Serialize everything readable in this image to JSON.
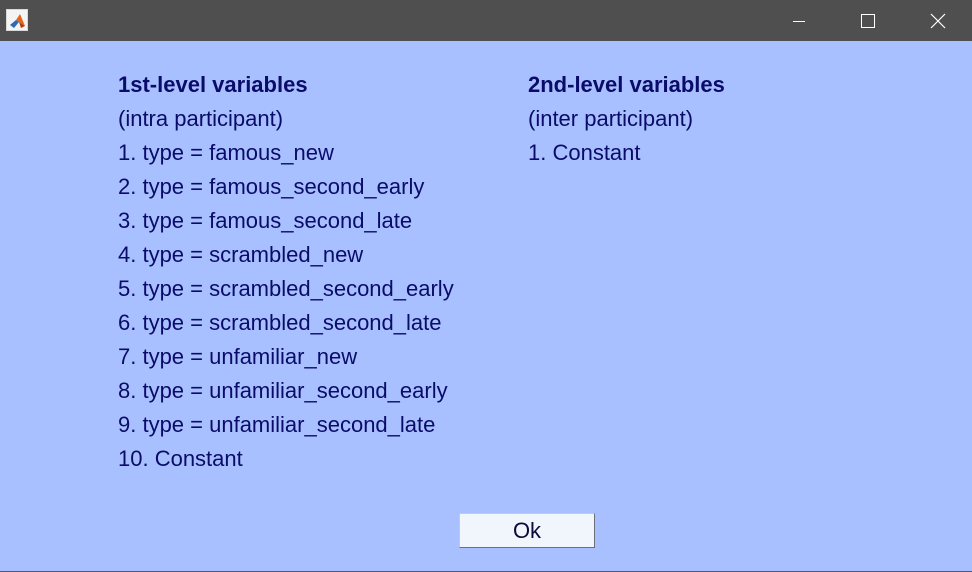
{
  "window": {
    "app_icon": "matlab-logo-icon",
    "controls": {
      "minimize_icon": "minimize-icon",
      "maximize_icon": "maximize-icon",
      "close_icon": "close-icon"
    }
  },
  "first_level": {
    "heading": "1st-level variables",
    "subheading": "(intra participant)",
    "items": [
      "1. type = famous_new",
      "2. type = famous_second_early",
      "3. type = famous_second_late",
      "4. type = scrambled_new",
      "5. type = scrambled_second_early",
      "6. type = scrambled_second_late",
      "7. type = unfamiliar_new",
      "8. type = unfamiliar_second_early",
      "9. type = unfamiliar_second_late",
      "10. Constant"
    ]
  },
  "second_level": {
    "heading": "2nd-level variables",
    "subheading": "(inter participant)",
    "items": [
      "1. Constant"
    ]
  },
  "ok_button": {
    "label": "Ok"
  },
  "colors": {
    "titlebar": "#4f4f4f",
    "background": "#a8c0ff",
    "text": "#0b0b6a",
    "button_face": "#f1f5fc"
  }
}
